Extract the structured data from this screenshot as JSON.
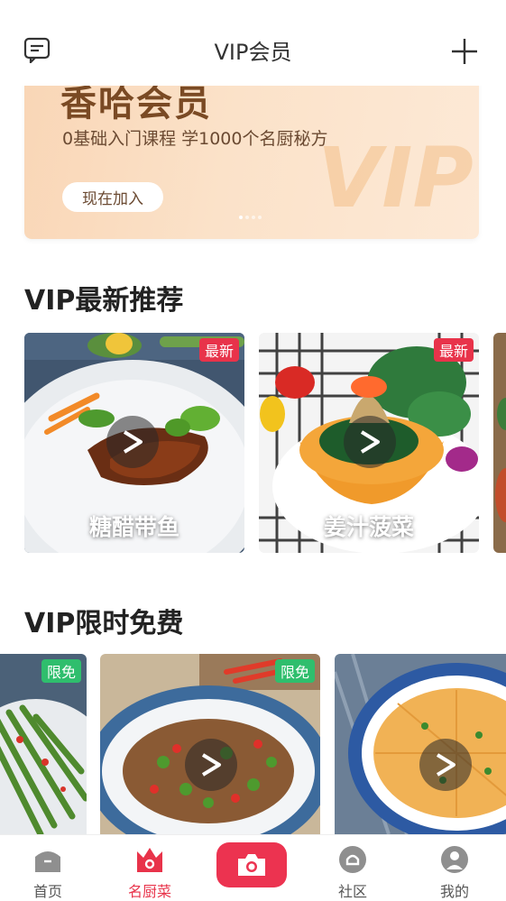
{
  "header": {
    "title": "VIP会员"
  },
  "banner": {
    "title": "香哈会员",
    "subtitle": "0基础入门课程 学1000个名厨秘方",
    "join_label": "现在加入",
    "watermark": "VIP"
  },
  "sections": {
    "latest": {
      "title": "VIP最新推荐",
      "items": [
        {
          "name": "糖醋带鱼",
          "badge": "最新"
        },
        {
          "name": "姜汁菠菜",
          "badge": "最新"
        }
      ]
    },
    "free": {
      "title": "VIP限时免费",
      "items": [
        {
          "badge": "限免"
        },
        {
          "badge": "限免"
        },
        {
          "badge": ""
        }
      ]
    }
  },
  "tabbar": {
    "items": [
      {
        "label": "首页",
        "icon": "home-icon"
      },
      {
        "label": "名厨菜",
        "icon": "crown-icon"
      },
      {
        "label": "",
        "icon": "camera-icon"
      },
      {
        "label": "社区",
        "icon": "community-icon"
      },
      {
        "label": "我的",
        "icon": "profile-icon"
      }
    ]
  },
  "colors": {
    "accent": "#e8334a",
    "free_badge": "#2fbe6d",
    "banner": "#fbe2c9"
  }
}
